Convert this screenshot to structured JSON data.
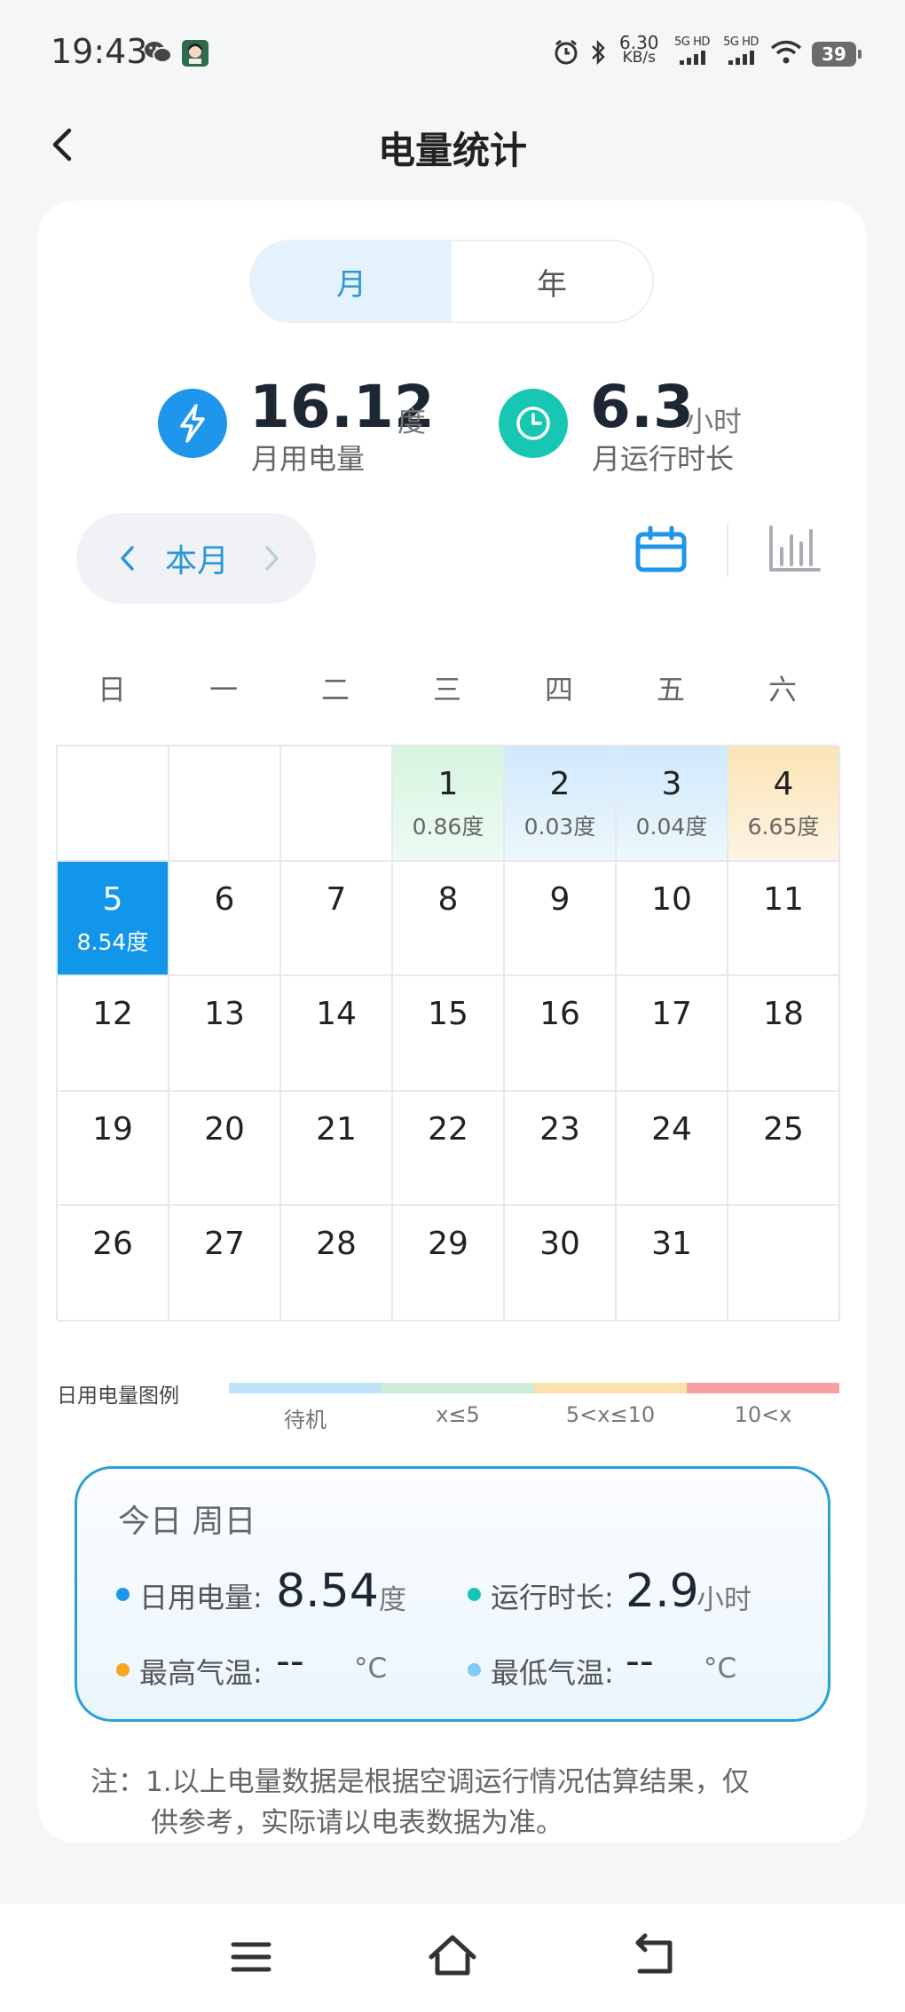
{
  "status_bar": {
    "time": "19:43",
    "net_speed_value": "6.30",
    "net_speed_unit": "KB/s",
    "signal1_label": "5G HD",
    "signal2_label": "5G HD",
    "battery": "39",
    "icons": [
      "wechat-icon",
      "avatar-icon",
      "alarm-icon",
      "bluetooth-icon",
      "signal-icon",
      "wifi-icon",
      "battery-icon"
    ]
  },
  "header": {
    "title": "电量统计",
    "back_icon": "chevron-left-icon"
  },
  "tabs": {
    "month": "月",
    "year": "年",
    "active": "month"
  },
  "summary": {
    "energy": {
      "value": "16.12",
      "unit": "度",
      "label": "月用电量",
      "icon": "lightning-icon",
      "color": "#1E96EB"
    },
    "runtime": {
      "value": "6.3",
      "unit": "小时",
      "label": "月运行时长",
      "icon": "clock-icon",
      "color": "#18C7B3"
    }
  },
  "month_nav": {
    "label": "本月"
  },
  "weekdays": [
    "日",
    "一",
    "二",
    "三",
    "四",
    "五",
    "六"
  ],
  "calendar": {
    "cells": [
      {
        "day": "",
        "value": ""
      },
      {
        "day": "",
        "value": ""
      },
      {
        "day": "",
        "value": ""
      },
      {
        "day": "1",
        "value": "0.86度",
        "level": "green"
      },
      {
        "day": "2",
        "value": "0.03度",
        "level": "blue"
      },
      {
        "day": "3",
        "value": "0.04度",
        "level": "blue"
      },
      {
        "day": "4",
        "value": "6.65度",
        "level": "yellow"
      },
      {
        "day": "5",
        "value": "8.54度",
        "level": "today"
      },
      {
        "day": "6",
        "value": ""
      },
      {
        "day": "7",
        "value": ""
      },
      {
        "day": "8",
        "value": ""
      },
      {
        "day": "9",
        "value": ""
      },
      {
        "day": "10",
        "value": ""
      },
      {
        "day": "11",
        "value": ""
      },
      {
        "day": "12",
        "value": ""
      },
      {
        "day": "13",
        "value": ""
      },
      {
        "day": "14",
        "value": ""
      },
      {
        "day": "15",
        "value": ""
      },
      {
        "day": "16",
        "value": ""
      },
      {
        "day": "17",
        "value": ""
      },
      {
        "day": "18",
        "value": ""
      },
      {
        "day": "19",
        "value": ""
      },
      {
        "day": "20",
        "value": ""
      },
      {
        "day": "21",
        "value": ""
      },
      {
        "day": "22",
        "value": ""
      },
      {
        "day": "23",
        "value": ""
      },
      {
        "day": "24",
        "value": ""
      },
      {
        "day": "25",
        "value": ""
      },
      {
        "day": "26",
        "value": ""
      },
      {
        "day": "27",
        "value": ""
      },
      {
        "day": "28",
        "value": ""
      },
      {
        "day": "29",
        "value": ""
      },
      {
        "day": "30",
        "value": ""
      },
      {
        "day": "31",
        "value": ""
      },
      {
        "day": "",
        "value": ""
      }
    ]
  },
  "legend": {
    "title": "日用电量图例",
    "items": [
      {
        "label": "待机",
        "color": "#BFE3F8"
      },
      {
        "label": "x≤5",
        "color": "#CDEFD9"
      },
      {
        "label": "5<x≤10",
        "color": "#FBE2AC"
      },
      {
        "label": "10<x",
        "color": "#F7A0A0"
      }
    ]
  },
  "today": {
    "title": "今日  周日",
    "energy": {
      "label": "日用电量:",
      "value": "8.54",
      "unit": "度",
      "dot_color": "#1E96EB"
    },
    "runtime": {
      "label": "运行时长:",
      "value": "2.9",
      "unit": "小时",
      "dot_color": "#18C7B3"
    },
    "max_temp": {
      "label": "最高气温:",
      "value": "--",
      "unit": "°C",
      "dot_color": "#F5A623"
    },
    "min_temp": {
      "label": "最低气温:",
      "value": "--",
      "unit": "°C",
      "dot_color": "#7FCBF5"
    }
  },
  "note": {
    "line1": "注：1.以上电量数据是根据空调运行情况估算结果，仅",
    "line2": "供参考，实际请以电表数据为准。"
  },
  "nav_bar": {
    "icons": [
      "menu-icon",
      "home-icon",
      "back-icon"
    ]
  }
}
